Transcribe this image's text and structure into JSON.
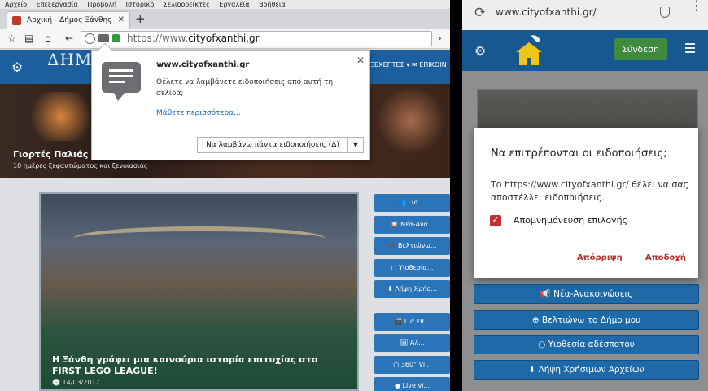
{
  "desktop": {
    "menu": [
      "Αρχείο",
      "Επεξεργασία",
      "Προβολή",
      "Ιστορικό",
      "Σελιδοδείκτες",
      "Εργαλεία",
      "Βοήθεια"
    ],
    "tab_title": "Αρχική - Δήμος Ξάνθης",
    "url_prefix": "https://www.",
    "url_domain": "cityofxanthi.gr",
    "site_logo": "ΔΗΜΟΣ ΞΑΝΘΗΣ",
    "nav_1": "ΞΕΧΕΠΤΕΣ ▾",
    "nav_2": "✉ ΕΠΙΚΟΙΝ",
    "hero_title": "Γιορτές Παλιάς Ξά",
    "hero_subtitle": "10 ημέρες ξεφαντώματος και ξενοιασιάς",
    "article_title": "Η Ξάνθη γράφει μια καινούρια ιστορία επιτυχίας στο FIRST LEGO LEAGUE!",
    "article_date": "14/03/2017",
    "side_buttons": [
      "👥 Για ...",
      "📢 Νέα-Ανα...",
      "➕ Βελτιώνω...",
      "○ Υιοθεσία...",
      "⬇ Λήψη Χρήσ...",
      "🎬 Για επ...",
      "🖼 Αλ...",
      "○ 360° Vi...",
      "● Live vi..."
    ]
  },
  "popup": {
    "title": "www.cityofxanthi.gr",
    "message": "Θέλετε να λαμβάνετε ειδοποιήσεις από αυτή τη σελίδα;",
    "learn_more": "Μάθετε περισσότερα...",
    "primary_button": "Να λαμβάνω πάντα ειδοποιήσεις (Δ)",
    "dropdown_arrow": "▼"
  },
  "mobile": {
    "url": "www.cityofxanthi.gr/",
    "login_button": "Σύνδεση",
    "buttons": [
      "📢 Νέα-Ανακοινώσεις",
      "⊕ Βελτιώνω το Δήμο μου",
      "○ Υιοθεσία αδέσποτου",
      "⬇ Λήψη Χρήσιμων Αρχείων"
    ]
  },
  "dialog": {
    "title": "Να επιτρέπονται οι ειδοποιήσεις;",
    "message": "Το https://www.cityofxanthi.gr/ θέλει να σας αποστέλλει ειδοποιήσεις.",
    "remember_label": "Απομνημόνευση επιλογής",
    "remember_checked": true,
    "deny": "Απόρριψη",
    "allow": "Αποδοχή"
  },
  "colors": {
    "site_blue": "#1b5f9e",
    "button_blue": "#1e69a8",
    "login_green": "#3f8b3d",
    "dialog_accent": "#c62f2f",
    "link_blue": "#1567c5"
  }
}
